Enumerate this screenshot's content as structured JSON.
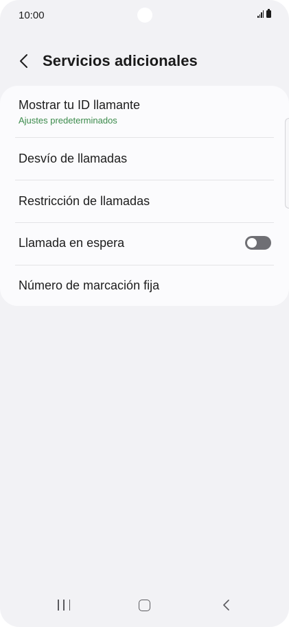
{
  "status_bar": {
    "time": "10:00",
    "icons": [
      "signal-icon",
      "battery-icon"
    ]
  },
  "header": {
    "back_icon": "chevron-left-icon",
    "title": "Servicios adicionales"
  },
  "settings": {
    "items": [
      {
        "label": "Mostrar tu ID llamante",
        "sublabel": "Ajustes predeterminados"
      },
      {
        "label": "Desvío de llamadas"
      },
      {
        "label": "Restricción de llamadas"
      },
      {
        "label": "Llamada en espera",
        "toggle": false
      },
      {
        "label": "Número de marcación fija"
      }
    ]
  },
  "colors": {
    "background": "#f2f2f5",
    "card": "#fbfbfd",
    "sublabel_green": "#3a8a4a",
    "toggle_off": "#6f6f74"
  },
  "nav_bar": {
    "icons": [
      "recents-icon",
      "home-icon",
      "back-icon"
    ]
  }
}
